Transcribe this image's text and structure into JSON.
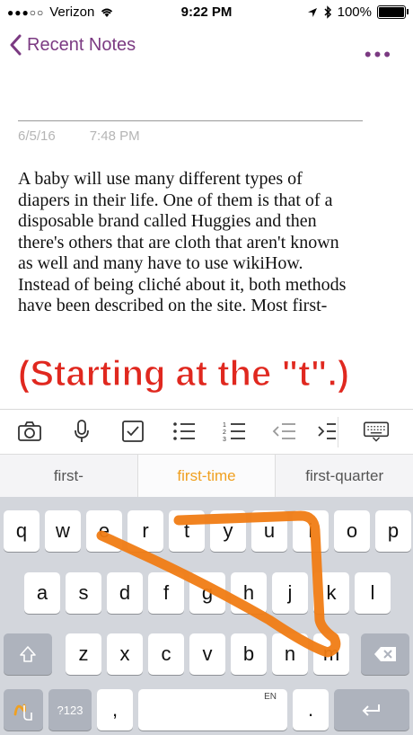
{
  "status": {
    "carrier": "Verizon",
    "time": "9:22 PM",
    "battery": "100%"
  },
  "nav": {
    "back_label": "Recent Notes",
    "more_label": "•••"
  },
  "note": {
    "date": "6/5/16",
    "time": "7:48 PM",
    "lines": [
      "A baby will use many different types of",
      "diapers in their life. One of them is that of a",
      "disposable brand called Huggies and then",
      "there's others that are cloth that aren't known",
      "as well and many have to use wikiHow.",
      "Instead of being cliché about it, both methods",
      "have been described on the site. Most first-"
    ]
  },
  "annotation": "(Starting at the \"t\".)",
  "toolbar": {
    "icons": [
      "camera-icon",
      "microphone-icon",
      "checkbox-icon",
      "bullet-list-icon",
      "numbered-list-icon",
      "outdent-icon",
      "indent-icon",
      "keyboard-hide-icon"
    ]
  },
  "suggestions": [
    "first-",
    "first-time",
    "first-quarter"
  ],
  "keyboard": {
    "row1": [
      "q",
      "w",
      "e",
      "r",
      "t",
      "y",
      "u",
      "i",
      "o",
      "p"
    ],
    "row2": [
      "a",
      "s",
      "d",
      "f",
      "g",
      "h",
      "j",
      "k",
      "l"
    ],
    "row3": [
      "z",
      "x",
      "c",
      "v",
      "b",
      "n",
      "m"
    ],
    "numbers_label": "?123",
    "comma": ",",
    "space_lang": "EN",
    "period": "."
  },
  "colors": {
    "accent": "#7b3a82",
    "annotation": "#e0281f",
    "suggestion_active": "#f0a020",
    "swipe": "#f07c14"
  }
}
